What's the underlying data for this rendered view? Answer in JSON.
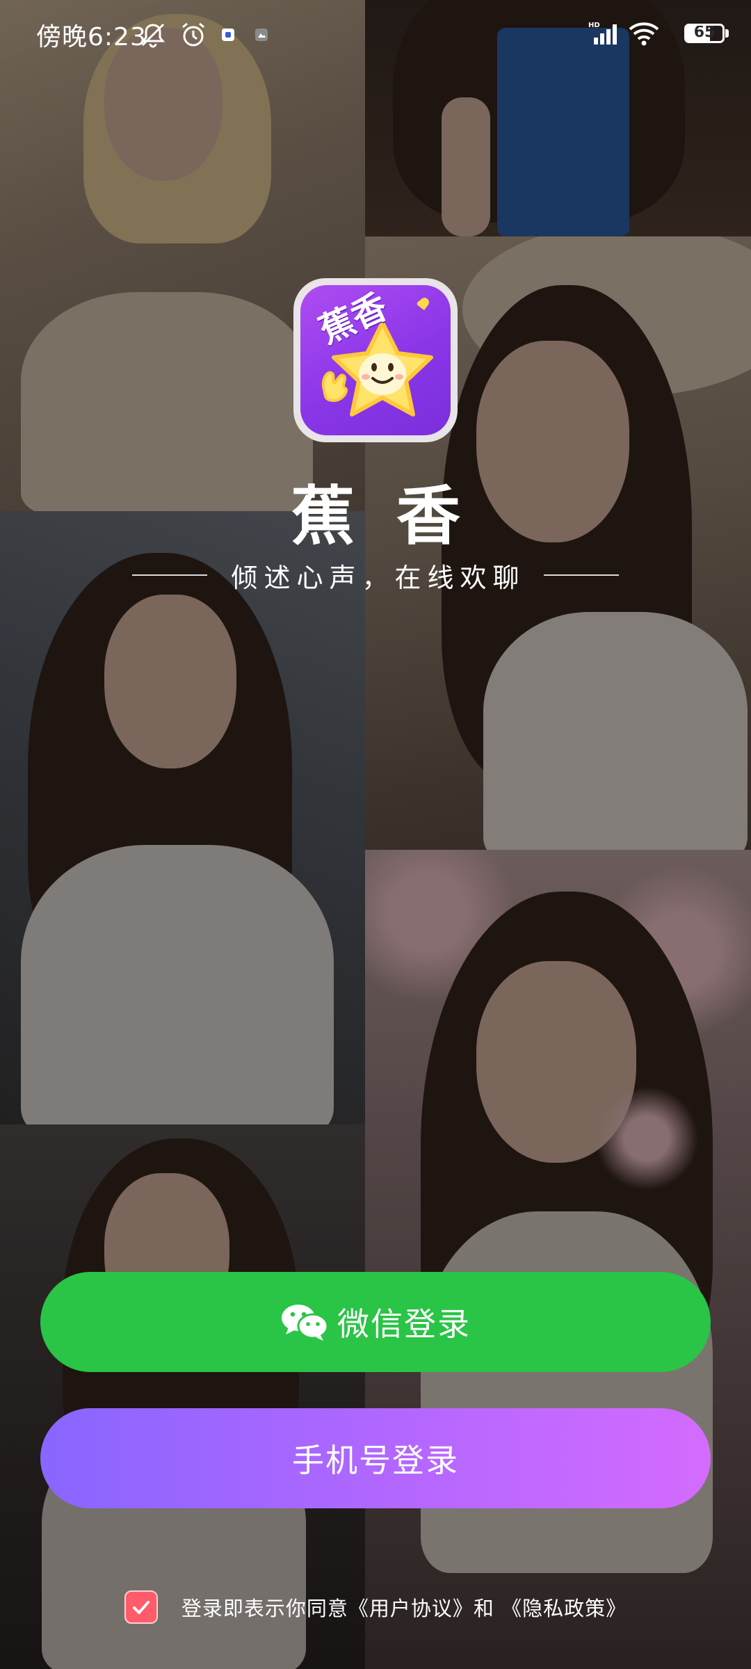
{
  "status_bar": {
    "time": "傍晚6:23",
    "icons": [
      "mute-bell-icon",
      "alarm-icon",
      "notification-app-icon",
      "notification-app-icon-2",
      "hd-signal-icon",
      "wifi-icon"
    ],
    "battery_level": 65,
    "battery_text": "65"
  },
  "app": {
    "icon_label": "蕉香",
    "name": "蕉香",
    "tagline": "倾述心声，在线欢聊"
  },
  "buttons": {
    "wechat_label": "微信登录",
    "wechat_icon": "wechat-icon",
    "phone_label": "手机号登录"
  },
  "agreement": {
    "checked": true,
    "prefix": "登录即表示你同意",
    "user_agreement": "《用户协议》",
    "conjunction": "和 ",
    "privacy_policy": "《隐私政策》"
  },
  "colors": {
    "wechat_green": "#2ac446",
    "phone_gradient_start": "#8866ff",
    "phone_gradient_end": "#d46bff",
    "checkbox_red": "#ff5b6b",
    "app_icon_purple": "#9a3ff0"
  }
}
